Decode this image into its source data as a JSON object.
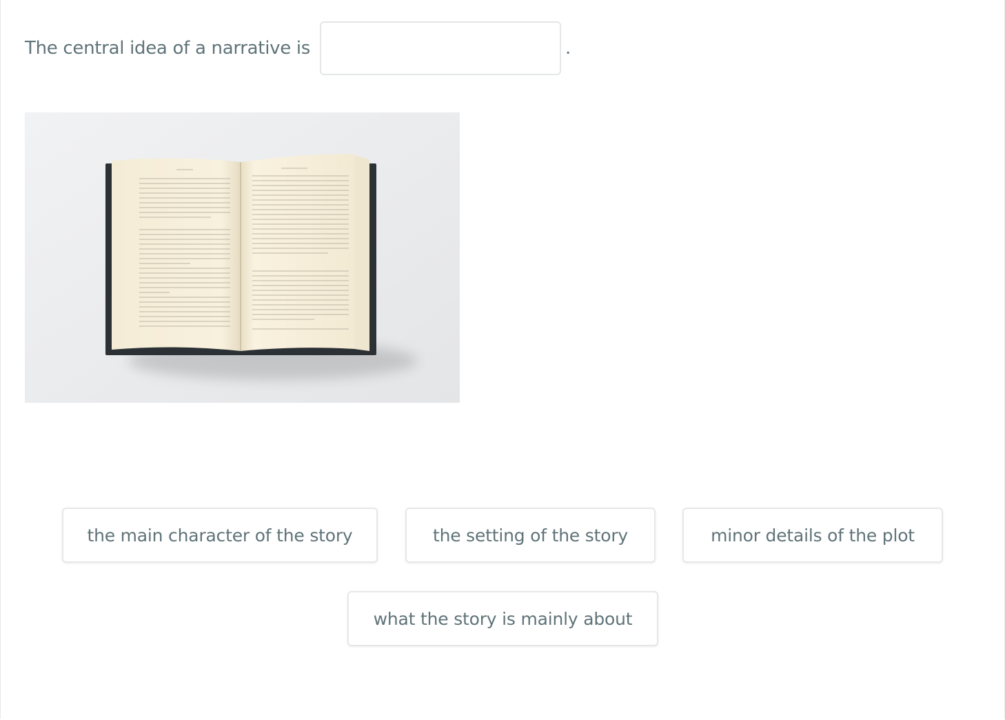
{
  "question": {
    "prompt": "The central idea of a narrative is",
    "blank_value": "",
    "period": "."
  },
  "choices": [
    {
      "label": "the main character of the story"
    },
    {
      "label": "the setting of the story"
    },
    {
      "label": "minor details of the plot"
    },
    {
      "label": "what the story is mainly about"
    }
  ],
  "colors": {
    "text": "#5f7379",
    "border": "#e6e8e8",
    "page_paper": "#f7efda"
  }
}
